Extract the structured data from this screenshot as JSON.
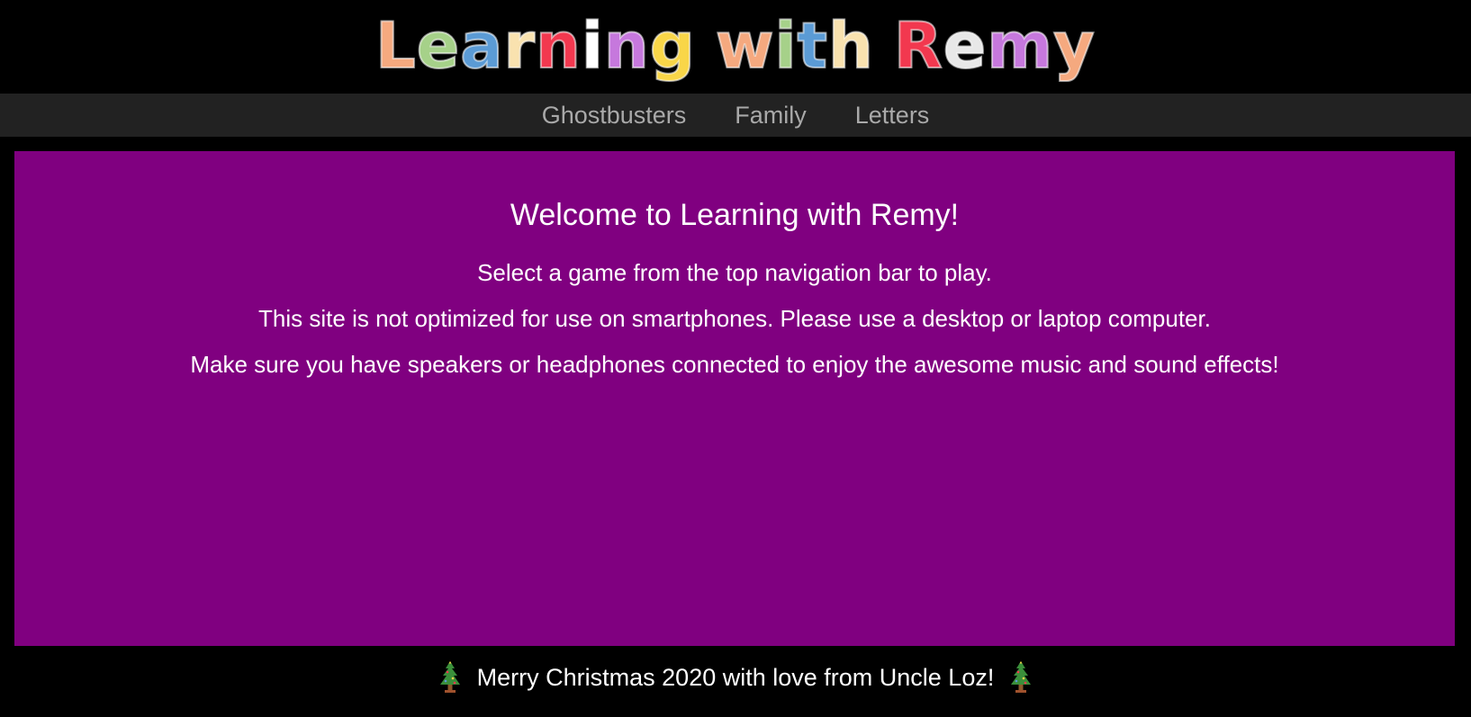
{
  "header": {
    "logo_letters": [
      {
        "ch": "L",
        "color": "#f5a97f"
      },
      {
        "ch": "e",
        "color": "#a6d189"
      },
      {
        "ch": "a",
        "color": "#5b9bd5"
      },
      {
        "ch": "r",
        "color": "#f9e2af"
      },
      {
        "ch": "n",
        "color": "#f2384f"
      },
      {
        "ch": "i",
        "color": "#ffffff"
      },
      {
        "ch": "n",
        "color": "#c678dd"
      },
      {
        "ch": "g",
        "color": "#f9d648"
      },
      {
        "ch": " ",
        "color": ""
      },
      {
        "ch": "w",
        "color": "#f5a97f"
      },
      {
        "ch": "i",
        "color": "#a6d189"
      },
      {
        "ch": "t",
        "color": "#5b9bd5"
      },
      {
        "ch": "h",
        "color": "#f9e2af"
      },
      {
        "ch": " ",
        "color": ""
      },
      {
        "ch": "R",
        "color": "#f2384f"
      },
      {
        "ch": "e",
        "color": "#e8e8e8"
      },
      {
        "ch": "m",
        "color": "#c678dd"
      },
      {
        "ch": "y",
        "color": "#f5a97f"
      }
    ]
  },
  "nav": {
    "items": [
      {
        "label": "Ghostbusters"
      },
      {
        "label": "Family"
      },
      {
        "label": "Letters"
      }
    ]
  },
  "main": {
    "title": "Welcome to Learning with Remy!",
    "lines": [
      "Select a game from the top navigation bar to play.",
      "This site is not optimized for use on smartphones. Please use a desktop or laptop computer.",
      "Make sure you have speakers or headphones connected to enjoy the awesome music and sound effects!"
    ]
  },
  "footer": {
    "text": "Merry Christmas 2020 with love from Uncle Loz!",
    "icon_left": "christmas-tree-icon",
    "icon_right": "christmas-tree-icon"
  },
  "colors": {
    "background": "#000000",
    "nav_background": "#222222",
    "nav_text": "#a9a9a9",
    "panel": "#800080",
    "text": "#ffffff"
  }
}
